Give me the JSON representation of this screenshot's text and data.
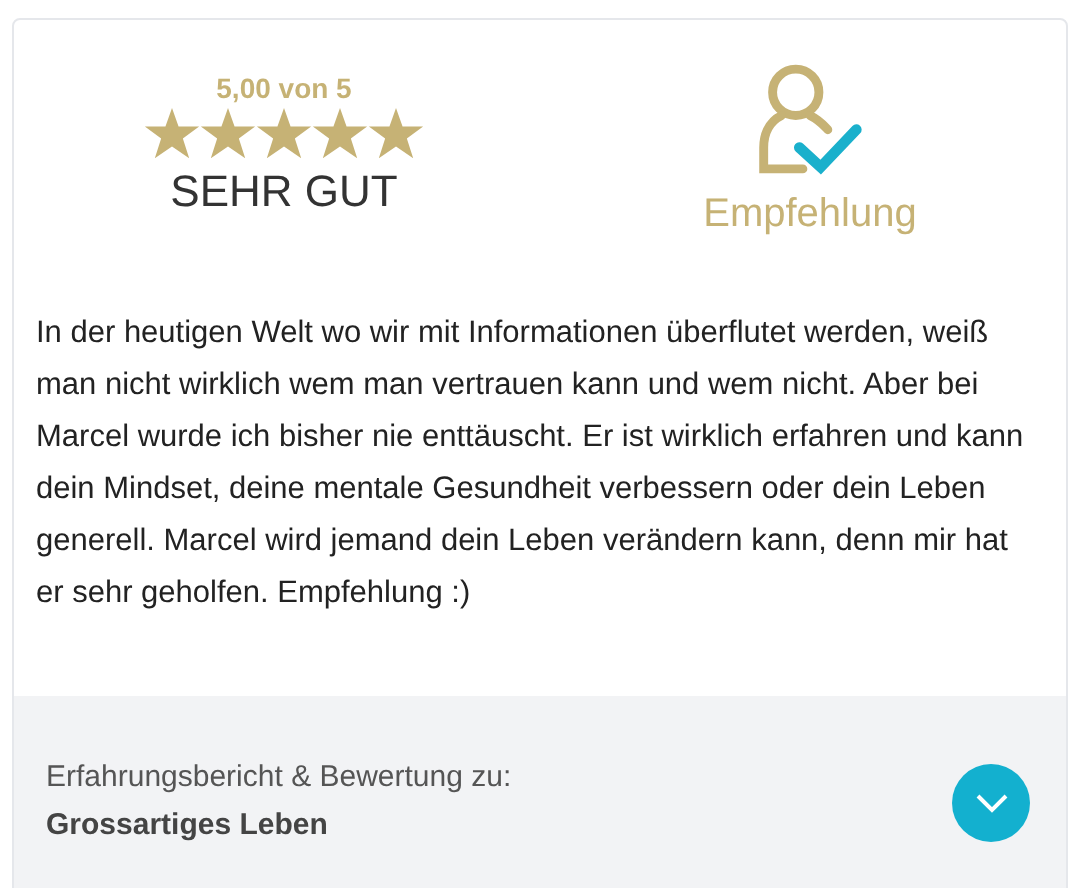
{
  "rating": {
    "score": "5,00 von 5",
    "stars": 5,
    "verdict": "SEHR GUT"
  },
  "recommendation": {
    "label": "Empfehlung"
  },
  "review": {
    "text": "In der heutigen Welt wo wir mit Informationen überflutet werden, weiß man nicht wirklich wem man vertrauen kann und wem nicht. Aber bei Marcel wurde ich bisher nie enttäuscht. Er ist wirklich erfahren und kann dein Mindset, deine mentale Gesundheit verbessern oder dein Leben generell. Marcel wird jemand dein Leben verändern kann, denn mir hat er sehr geholfen. Empfehlung :)"
  },
  "footer": {
    "caption": "Erfahrungsbericht & Bewertung zu:",
    "title": "Grossartiges Leben",
    "expanded": false
  }
}
